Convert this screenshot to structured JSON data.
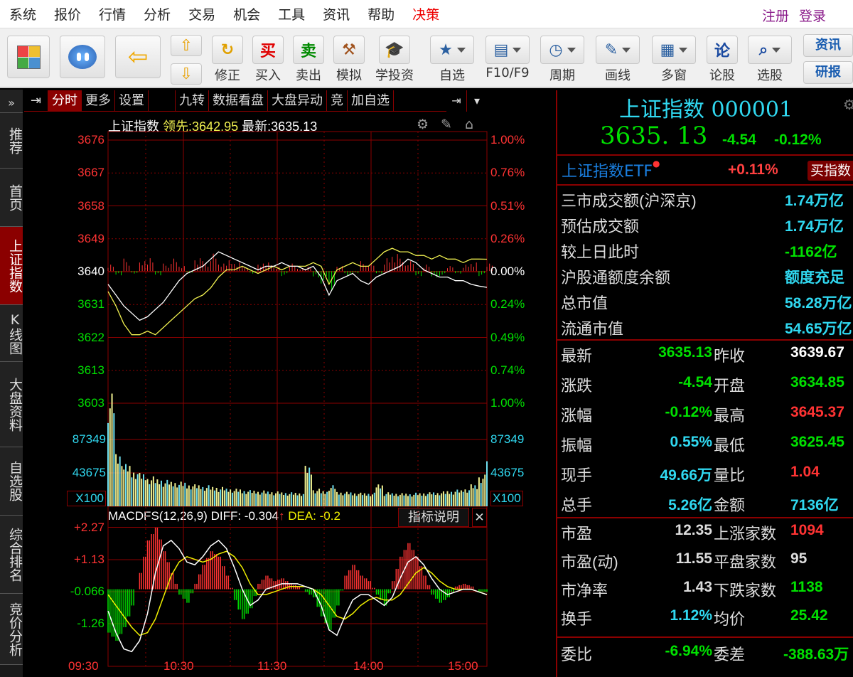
{
  "menu": [
    "系统",
    "报价",
    "行情",
    "分析",
    "交易",
    "机会",
    "工具",
    "资讯",
    "帮助",
    "决策"
  ],
  "menu_right": [
    "注册",
    "登录"
  ],
  "toolbar": {
    "items": [
      {
        "icon": "correct-icon",
        "label": "修正",
        "glyph": "↻",
        "color": "#e0a000"
      },
      {
        "icon": "buy-icon",
        "label": "买入",
        "glyph": "买",
        "color": "#e00000"
      },
      {
        "icon": "sell-icon",
        "label": "卖出",
        "glyph": "卖",
        "color": "#008a00"
      },
      {
        "icon": "gavel-icon",
        "label": "模拟",
        "glyph": "⚒",
        "color": "#a0521d"
      },
      {
        "icon": "graduation-cap-icon",
        "label": "学投资",
        "glyph": "🎓",
        "color": "#3a7fc0"
      },
      {
        "icon": "folder-star-icon",
        "label": "自选",
        "glyph": "★",
        "color": "#2a5fa0",
        "dd": true
      },
      {
        "icon": "f10-icon",
        "label": "F10/F9",
        "glyph": "▤",
        "color": "#2a5fa0",
        "dd": true
      },
      {
        "icon": "clock-icon",
        "label": "周期",
        "glyph": "◷",
        "color": "#2a5fa0",
        "dd": true
      },
      {
        "icon": "pencil-icon",
        "label": "画线",
        "glyph": "✎",
        "color": "#2a5fa0",
        "dd": true
      },
      {
        "icon": "multi-window-icon",
        "label": "多窗",
        "glyph": "▦",
        "color": "#2a5fa0",
        "dd": true
      },
      {
        "icon": "forum-icon",
        "label": "论股",
        "glyph": "论",
        "color": "#1a4aa0"
      },
      {
        "icon": "stock-picker-icon",
        "label": "选股",
        "glyph": "⌕",
        "color": "#1a4aa0",
        "dd": true
      }
    ],
    "side_buttons": [
      "资讯",
      "研报"
    ]
  },
  "sidebar": [
    {
      "label": "推荐"
    },
    {
      "label": "首页"
    },
    {
      "label": "上证指数",
      "active": true
    },
    {
      "label": "K线图"
    },
    {
      "label": "大盘资料"
    },
    {
      "label": "自选股"
    },
    {
      "label": "综合排名"
    },
    {
      "label": "竞价分析"
    }
  ],
  "tabs": [
    "分时",
    "更多",
    "设置",
    "",
    "九转",
    "数据看盘",
    "大盘异动",
    "竞",
    "加自选"
  ],
  "header": {
    "name": "上证指数",
    "lead_label": "领先:",
    "lead": "3642.95",
    "latest_label": "最新:",
    "latest": "3635.13"
  },
  "macd_header": {
    "name": "MACDFS(12,26,9)",
    "diff": "DIFF: -0.304",
    "arrow": "↑",
    "dea": "DEA: -0.2",
    "explain": "指标说明",
    "close": "✕"
  },
  "colors": {
    "up": "#ff3333",
    "down": "#00e000",
    "price_line": "#ffffff",
    "lead_line": "#f0f050",
    "grid": "#8b0000",
    "volume_up": "#f0f090",
    "volume_cyan": "#70e0f0"
  },
  "chart_data": {
    "type": "line",
    "price_ticks": [
      "3676",
      "3667",
      "3658",
      "3649",
      "3640",
      "3631",
      "3622",
      "3613",
      "3603"
    ],
    "pct_ticks": [
      "1.00%",
      "0.76%",
      "0.51%",
      "0.26%",
      "0.00%",
      "0.24%",
      "0.49%",
      "0.74%",
      "1.00%"
    ],
    "prev_close": 3639.67,
    "ylim": [
      3603,
      3676
    ],
    "volume_ticks": [
      "87349",
      "43675",
      "X100"
    ],
    "volume_max": 134700,
    "macd_ticks": [
      "+2.27",
      "+1.13",
      "-0.066",
      "-1.26"
    ],
    "macd_ylim": [
      -2.45,
      2.27
    ],
    "time_ticks": [
      "09:30",
      "10:30",
      "11:30",
      "14:00",
      "15:00"
    ],
    "price": [
      3636,
      3633,
      3630,
      3628,
      3626,
      3627,
      3629,
      3631,
      3634,
      3637,
      3639,
      3640,
      3641,
      3643,
      3645,
      3644,
      3643,
      3642,
      3641,
      3640,
      3641,
      3641,
      3642,
      3641,
      3641,
      3640,
      3641,
      3638,
      3633,
      3637,
      3638,
      3639,
      3637,
      3636,
      3638,
      3639,
      3640,
      3641,
      3643,
      3642,
      3640,
      3639,
      3638,
      3638,
      3637,
      3637,
      3636,
      3635.5,
      3635.13
    ],
    "lead": [
      3634,
      3630,
      3625,
      3622,
      3622,
      3623,
      3622,
      3624,
      3626,
      3628,
      3630,
      3632,
      3633,
      3635,
      3638,
      3640,
      3640,
      3641,
      3640,
      3639,
      3640,
      3641,
      3640,
      3641,
      3641,
      3641,
      3642,
      3641,
      3636,
      3640,
      3641,
      3642,
      3641,
      3641,
      3643,
      3645,
      3646,
      3645,
      3645,
      3644,
      3644,
      3643,
      3644,
      3643,
      3643,
      3642,
      3643,
      3643,
      3642.95
    ],
    "strength": [
      3,
      -2,
      5,
      -1,
      4,
      6,
      -2,
      3,
      5,
      2,
      -1,
      6,
      4,
      7,
      3,
      5,
      4,
      2,
      -1,
      3,
      4,
      2,
      -2,
      3,
      1,
      2,
      -3,
      -5,
      -8,
      2,
      -2,
      -1,
      4,
      3,
      -1,
      6,
      8,
      5,
      4,
      -2,
      3,
      -3,
      -2,
      2,
      -1,
      3,
      4,
      -2,
      3
    ],
    "volume": [
      128000,
      62000,
      48000,
      42000,
      38000,
      34000,
      32000,
      30000,
      29000,
      28000,
      26000,
      25000,
      24000,
      23000,
      22000,
      21000,
      20000,
      19000,
      18500,
      18000,
      17500,
      17000,
      16500,
      16000,
      16000,
      46000,
      20000,
      18000,
      24000,
      17000,
      16500,
      16000,
      15500,
      15500,
      26000,
      16000,
      15500,
      15000,
      15000,
      15500,
      16000,
      16500,
      17000,
      18000,
      19000,
      21000,
      25000,
      36000,
      62000
    ],
    "macd": [
      -1.6,
      -1.9,
      -1.4,
      -0.6,
      0.6,
      1.8,
      2.27,
      1.4,
      0.6,
      -0.2,
      -0.5,
      0.2,
      0.9,
      1.4,
      1.2,
      0.5,
      -0.4,
      -1.1,
      -0.7,
      0.2,
      0.5,
      0.3,
      0.4,
      0.2,
      0.1,
      -0.1,
      -0.3,
      -1.0,
      -1.5,
      -0.6,
      0.5,
      0.9,
      0.5,
      0.3,
      -0.2,
      -0.6,
      0.3,
      1.2,
      1.7,
      1.2,
      0.5,
      -0.2,
      -0.5,
      -0.3,
      0.1,
      0.2,
      0.1,
      -0.1,
      -0.1
    ],
    "diff": [
      -0.8,
      -1.6,
      -2.2,
      -2.3,
      -1.9,
      -0.9,
      0.6,
      1.6,
      1.8,
      1.5,
      1.0,
      0.9,
      1.2,
      1.6,
      1.8,
      1.5,
      0.8,
      0.0,
      -0.6,
      -0.4,
      0.0,
      0.1,
      0.2,
      0.2,
      0.2,
      0.1,
      0.0,
      -0.6,
      -1.5,
      -1.7,
      -1.0,
      -0.4,
      -0.2,
      -0.2,
      -0.4,
      -0.6,
      -0.3,
      0.4,
      1.0,
      1.2,
      0.9,
      0.4,
      0.0,
      -0.2,
      -0.1,
      0.0,
      0.0,
      -0.1,
      -0.2
    ],
    "dea": [
      -0.2,
      -0.6,
      -1.0,
      -1.4,
      -1.7,
      -1.6,
      -1.1,
      -0.3,
      0.5,
      1.0,
      1.2,
      1.1,
      1.0,
      1.1,
      1.3,
      1.4,
      1.2,
      0.8,
      0.2,
      -0.2,
      -0.2,
      -0.1,
      0.0,
      0.1,
      0.1,
      0.1,
      0.0,
      -0.2,
      -0.6,
      -1.0,
      -1.1,
      -0.9,
      -0.6,
      -0.4,
      -0.3,
      -0.4,
      -0.4,
      -0.2,
      0.2,
      0.6,
      0.8,
      0.6,
      0.3,
      0.1,
      0.0,
      0.0,
      0.0,
      -0.1,
      -0.2
    ]
  },
  "quote": {
    "title": "上证指数 000001",
    "price": "3635. 13",
    "change": "-4.54",
    "pct": "-0.12%",
    "etf": {
      "name": "上证指数ETF",
      "pct": "+0.11%",
      "button": "买指数"
    },
    "market": [
      {
        "label": "三市成交额(沪深京)",
        "value": "1.74万亿",
        "color": "#30d8f0"
      },
      {
        "label": "预估成交额",
        "value": "1.74万亿",
        "color": "#30d8f0"
      },
      {
        "label": "较上日此时",
        "value": "-1162亿",
        "color": "#00e000"
      },
      {
        "label": "沪股通额度余额",
        "value": "额度充足",
        "color": "#30d8f0"
      },
      {
        "label": "总市值",
        "value": "58.28万亿",
        "color": "#30d8f0"
      },
      {
        "label": "流通市值",
        "value": "54.65万亿",
        "color": "#30d8f0"
      }
    ],
    "stats": [
      {
        "l1": "最新",
        "v1": "3635.13",
        "c1": "#00e000",
        "l2": "昨收",
        "v2": "3639.67",
        "c2": "#ffffff"
      },
      {
        "l1": "涨跌",
        "v1": "-4.54",
        "c1": "#00e000",
        "l2": "开盘",
        "v2": "3634.85",
        "c2": "#00e000"
      },
      {
        "l1": "涨幅",
        "v1": "-0.12%",
        "c1": "#00e000",
        "l2": "最高",
        "v2": "3645.37",
        "c2": "#ff3333"
      },
      {
        "l1": "振幅",
        "v1": "0.55%",
        "c1": "#30d8f0",
        "l2": "最低",
        "v2": "3625.45",
        "c2": "#00e000"
      },
      {
        "l1": "现手",
        "v1": "49.66万",
        "c1": "#30d8f0",
        "l2": "量比",
        "v2": "1.04",
        "c2": "#ff3333"
      },
      {
        "l1": "总手",
        "v1": "5.26亿",
        "c1": "#30d8f0",
        "l2": "金额",
        "v2": "7136亿",
        "c2": "#30d8f0"
      }
    ],
    "stats2": [
      {
        "l1": "市盈",
        "v1": "12.35",
        "c1": "#dddddd",
        "l2": "上涨家数",
        "v2": "1094",
        "c2": "#ff3333"
      },
      {
        "l1": "市盈(动)",
        "v1": "11.55",
        "c1": "#dddddd",
        "l2": "平盘家数",
        "v2": "95",
        "c2": "#dddddd"
      },
      {
        "l1": "市净率",
        "v1": "1.43",
        "c1": "#dddddd",
        "l2": "下跌家数",
        "v2": "1138",
        "c2": "#00e000"
      },
      {
        "l1": "换手",
        "v1": "1.12%",
        "c1": "#30d8f0",
        "l2": "均价",
        "v2": "25.42",
        "c2": "#00e000"
      }
    ],
    "order": {
      "l1": "委比",
      "v1": "-6.94%",
      "l2": "委差",
      "v2": "-388.63万"
    }
  }
}
